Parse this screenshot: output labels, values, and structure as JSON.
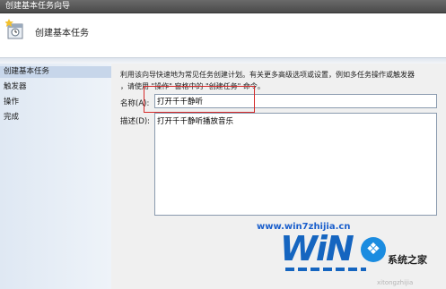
{
  "window": {
    "title": "创建基本任务向导"
  },
  "header": {
    "heading": "创建基本任务",
    "icon": "wizard-icon"
  },
  "sidebar": {
    "steps": [
      {
        "label": "创建基本任务",
        "active": true
      },
      {
        "label": "触发器",
        "active": false
      },
      {
        "label": "操作",
        "active": false
      },
      {
        "label": "完成",
        "active": false
      }
    ]
  },
  "form": {
    "description_line1": "利用该向导快速地为常见任务创建计划。有关更多高级选项或设置，例如多任务操作或触发器",
    "description_line2": "，请使用 \"操作\" 窗格中的 \"创建任务\" 命令。",
    "name_label": "名称(A):",
    "name_value": "打开千千静听",
    "desc_label": "描述(D):",
    "desc_value": "打开千千静听播放音乐"
  },
  "watermark": {
    "url": "www.win7zhijia.cn",
    "logo_text": "WiN",
    "site_name": "系统之家",
    "faint_text": "xitongzhijia"
  },
  "colors": {
    "highlight_border": "#d62b2b",
    "sidebar_active": "#c7d6ea",
    "watermark_blue": "#1565c0"
  }
}
